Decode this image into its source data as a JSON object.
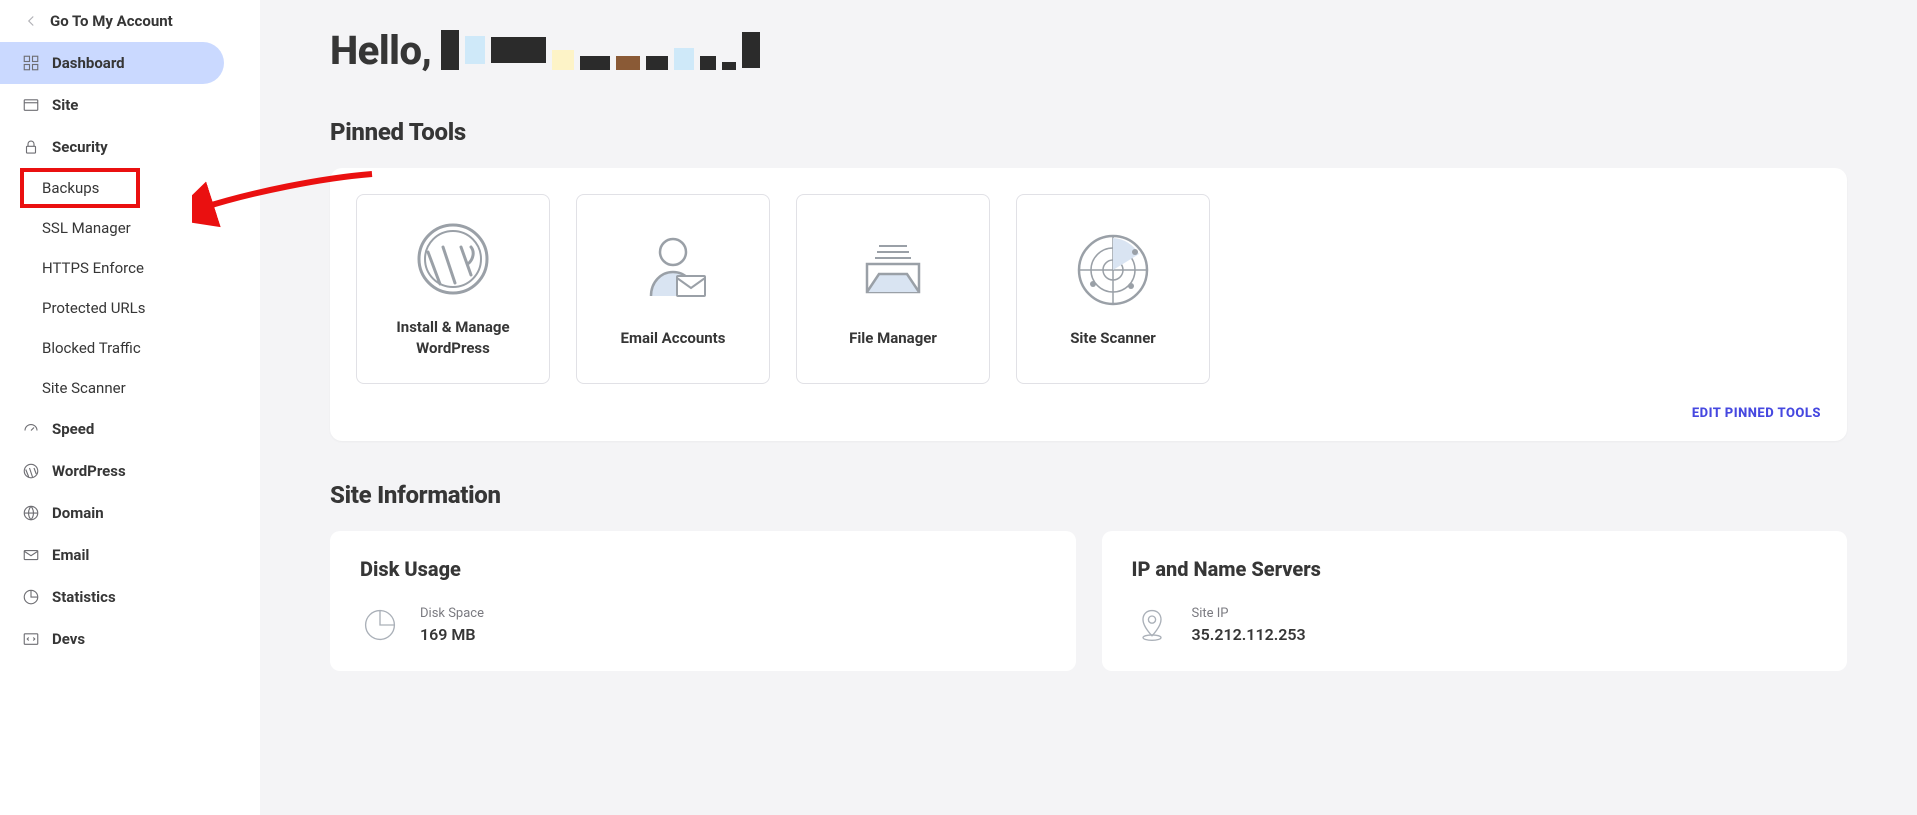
{
  "sidebar": {
    "back_label": "Go To My Account",
    "items": {
      "dashboard": "Dashboard",
      "site": "Site",
      "security": "Security",
      "speed": "Speed",
      "wordpress": "WordPress",
      "domain": "Domain",
      "email": "Email",
      "statistics": "Statistics",
      "devs": "Devs"
    },
    "security_sub": {
      "backups": "Backups",
      "ssl": "SSL Manager",
      "https": "HTTPS Enforce",
      "protected": "Protected URLs",
      "blocked": "Blocked Traffic",
      "scanner": "Site Scanner"
    }
  },
  "main": {
    "hello_prefix": "Hello,",
    "pinned_title": "Pinned Tools",
    "tools": {
      "wordpress": "Install & Manage WordPress",
      "email": "Email Accounts",
      "file": "File Manager",
      "scanner": "Site Scanner"
    },
    "edit_pinned": "EDIT PINNED TOOLS",
    "site_info_title": "Site Information",
    "disk": {
      "title": "Disk Usage",
      "label": "Disk Space",
      "value": "169 MB"
    },
    "ip": {
      "title": "IP and Name Servers",
      "label": "Site IP",
      "value": "35.212.112.253"
    }
  }
}
